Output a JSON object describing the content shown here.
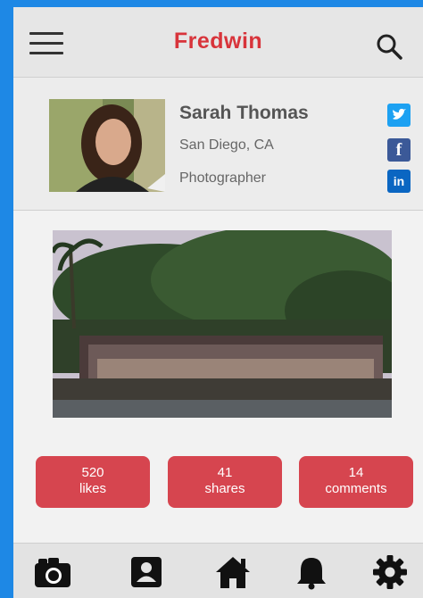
{
  "header": {
    "title": "Fredwin"
  },
  "profile": {
    "name": "Sarah Thomas",
    "location": "San Diego, CA",
    "occupation": "Photographer",
    "social": [
      {
        "icon": "twitter-icon",
        "color": "#1da1f2"
      },
      {
        "icon": "facebook-icon",
        "glyph": "f",
        "color": "#3b5998"
      },
      {
        "icon": "linkedin-icon",
        "glyph": "in",
        "color": "#0a66c2"
      }
    ]
  },
  "stats": {
    "likes": {
      "count": "520",
      "label": "likes"
    },
    "shares": {
      "count": "41",
      "label": "shares"
    },
    "comments": {
      "count": "14",
      "label": "comments"
    }
  },
  "nav": [
    "camera-icon",
    "profile-card-icon",
    "home-icon",
    "bell-icon",
    "gear-icon"
  ],
  "colors": {
    "brand": "#d8343b",
    "stat_button": "#d6454f",
    "frame": "#1e88e5"
  }
}
